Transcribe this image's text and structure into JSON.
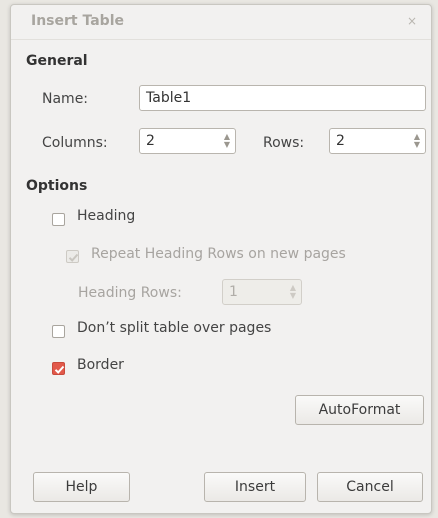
{
  "window": {
    "title": "Insert Table",
    "close_glyph": "×"
  },
  "general": {
    "heading": "General",
    "name_label": "Name:",
    "name_value": "Table1",
    "columns_label": "Columns:",
    "columns_value": "2",
    "rows_label": "Rows:",
    "rows_value": "2"
  },
  "options": {
    "heading": "Options",
    "heading_checkbox": {
      "label": "Heading",
      "checked": false
    },
    "repeat_heading": {
      "label": "Repeat Heading Rows on new pages",
      "checked": true,
      "enabled": false
    },
    "heading_rows": {
      "label": "Heading Rows:",
      "value": "1",
      "enabled": false
    },
    "dont_split": {
      "label": "Don’t split table over pages",
      "checked": false
    },
    "border": {
      "label": "Border",
      "checked": true
    }
  },
  "buttons": {
    "autoformat": "AutoFormat",
    "help": "Help",
    "insert": "Insert",
    "cancel": "Cancel"
  },
  "icons": [
    "close-icon",
    "spin-up-icon",
    "spin-down-icon",
    "checkmark-icon"
  ],
  "colors": {
    "accent_checkbox": "#e2594a",
    "dialog_bg": "#f2f1f0"
  }
}
